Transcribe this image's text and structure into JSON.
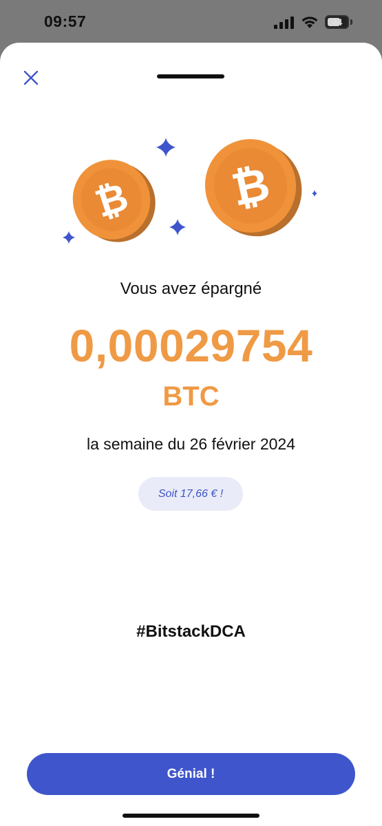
{
  "status_bar": {
    "time": "09:57",
    "battery_level": "44",
    "icons": [
      "signal-icon",
      "wifi-icon",
      "battery-icon"
    ]
  },
  "sheet": {
    "close_icon": "close-icon",
    "illustration_icons": [
      "bitcoin-coin-icon",
      "bitcoin-coin-icon",
      "sparkle-icon",
      "sparkle-icon",
      "sparkle-icon",
      "sparkle-icon"
    ]
  },
  "summary": {
    "title": "Vous avez épargné",
    "amount": "0,00029754",
    "unit": "BTC",
    "period": "la semaine du 26 février 2024",
    "equivalent": "Soit 17,66 € !",
    "hashtag": "#BitstackDCA"
  },
  "actions": {
    "confirm_label": "Génial !"
  },
  "colors": {
    "accent": "#3f55cc",
    "bitcoin_orange": "#ef9a45",
    "badge_bg": "#e9ebf8"
  }
}
